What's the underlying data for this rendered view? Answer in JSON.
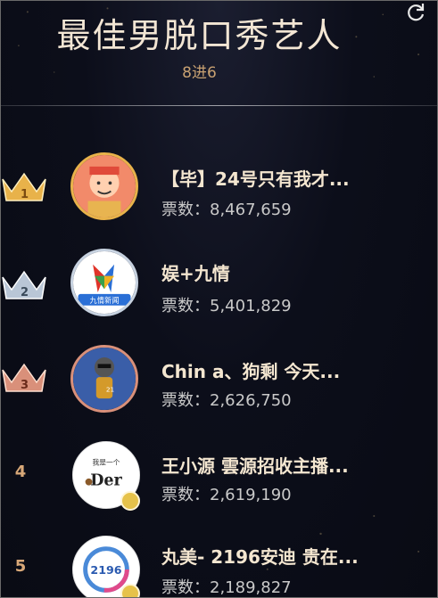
{
  "header": {
    "title": "最佳男脱口秀艺人",
    "subtitle": "8进6"
  },
  "vote_label": "票数：",
  "entries": [
    {
      "rank": "1",
      "name": "【毕】24号只有我才...",
      "votes": "8,467,659"
    },
    {
      "rank": "2",
      "name": "娱+九情",
      "votes": "5,401,829"
    },
    {
      "rank": "3",
      "name": "Chin a、狗剩 今天...",
      "votes": "2,626,750"
    },
    {
      "rank": "4",
      "name": "王小源 雲源招收主播...",
      "votes": "2,619,190"
    },
    {
      "rank": "5",
      "name": "丸美- 2196安迪 贵在...",
      "votes": "2,189,827"
    }
  ],
  "avatar_text": {
    "a2": "九情新闻",
    "a4_top": "我是一个",
    "a4_main": "Der",
    "a5": "2196"
  },
  "colors": {
    "gold": "#e8b24a",
    "silver": "#b9c6d6",
    "bronze": "#d9907a",
    "rank_text": "#d8a878"
  }
}
